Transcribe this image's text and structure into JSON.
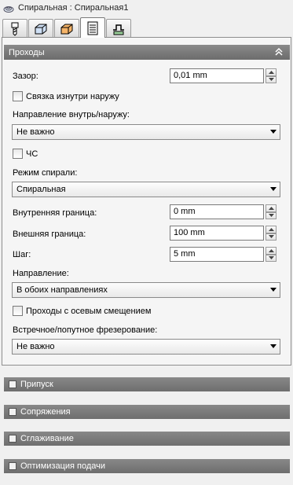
{
  "window": {
    "title": "Спиральная : Спиральная1",
    "icon": "spiral-operation-icon"
  },
  "tabs": [
    {
      "name": "tool-tab",
      "icon": "tool-icon"
    },
    {
      "name": "geometry-tab",
      "icon": "geometry-box-icon"
    },
    {
      "name": "heights-tab",
      "icon": "heights-box-icon"
    },
    {
      "name": "passes-tab",
      "icon": "passes-list-icon",
      "active": true
    },
    {
      "name": "linking-tab",
      "icon": "linking-icon"
    }
  ],
  "section": {
    "title": "Проходы",
    "clearance_label": "Зазор:",
    "clearance_value": "0,01 mm",
    "inside_out_label": "Связка изнутри наружу",
    "direction_inout_label": "Направление внутрь/наружу:",
    "direction_inout_value": "Не важно",
    "cw_label": "ЧС",
    "spiral_mode_label": "Режим спирали:",
    "spiral_mode_value": "Спиральная",
    "inner_label": "Внутренняя граница:",
    "inner_value": "0 mm",
    "outer_label": "Внешняя граница:",
    "outer_value": "100 mm",
    "step_label": "Шаг:",
    "step_value": "5 mm",
    "direction_label": "Направление:",
    "direction_value": "В обоих направлениях",
    "axial_label": "Проходы с осевым смещением",
    "milling_label": "Встречное/попутное фрезерование:",
    "milling_value": "Не важно"
  },
  "collapsed": {
    "stock": "Припуск",
    "fillets": "Сопряжения",
    "smoothing": "Сглаживание",
    "feed": "Оптимизация подачи"
  }
}
